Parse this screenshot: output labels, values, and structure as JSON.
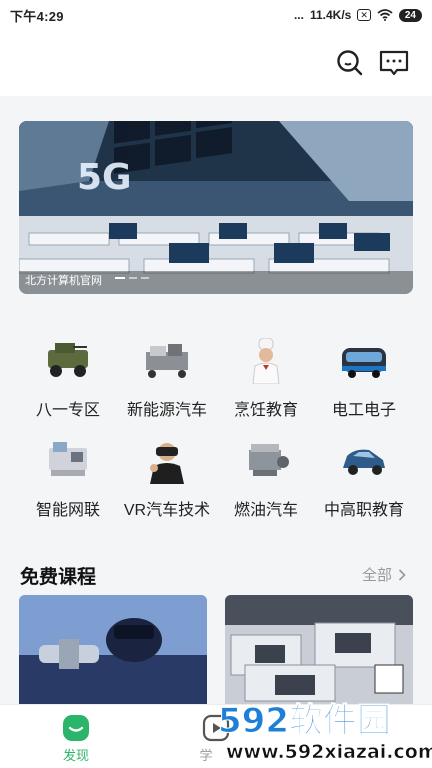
{
  "status_bar": {
    "time": "下午4:29",
    "signal_dots": "...",
    "net_speed": "11.4K/s",
    "sim_badge": "✕",
    "battery": "24"
  },
  "header": {
    "search_icon": "search-icon",
    "message_icon": "message-icon"
  },
  "banner": {
    "caption": "北方计算机官网",
    "slide_count": 3,
    "active_slide": 1
  },
  "categories": [
    {
      "label": "八一专区",
      "icon": "military-vehicle-image"
    },
    {
      "label": "新能源汽车",
      "icon": "ev-powertrain-image"
    },
    {
      "label": "烹饪教育",
      "icon": "chef-image"
    },
    {
      "label": "电工电子",
      "icon": "bus-image"
    },
    {
      "label": "智能网联",
      "icon": "smart-equipment-image"
    },
    {
      "label": "VR汽车技术",
      "icon": "vr-headset-image"
    },
    {
      "label": "燃油汽车",
      "icon": "engine-image"
    },
    {
      "label": "中高职教育",
      "icon": "car-cutaway-image"
    }
  ],
  "free_courses": {
    "title": "免费课程",
    "more_label": "全部"
  },
  "bottom_nav": [
    {
      "label": "发现",
      "active": true
    },
    {
      "label": "学"
    }
  ],
  "watermark": {
    "logo_text": "592软件园",
    "url": "www.592xiazai.com"
  },
  "colors": {
    "accent": "#2bb56a",
    "muted": "#999999",
    "watermark_blue": "#1e7fd8"
  }
}
